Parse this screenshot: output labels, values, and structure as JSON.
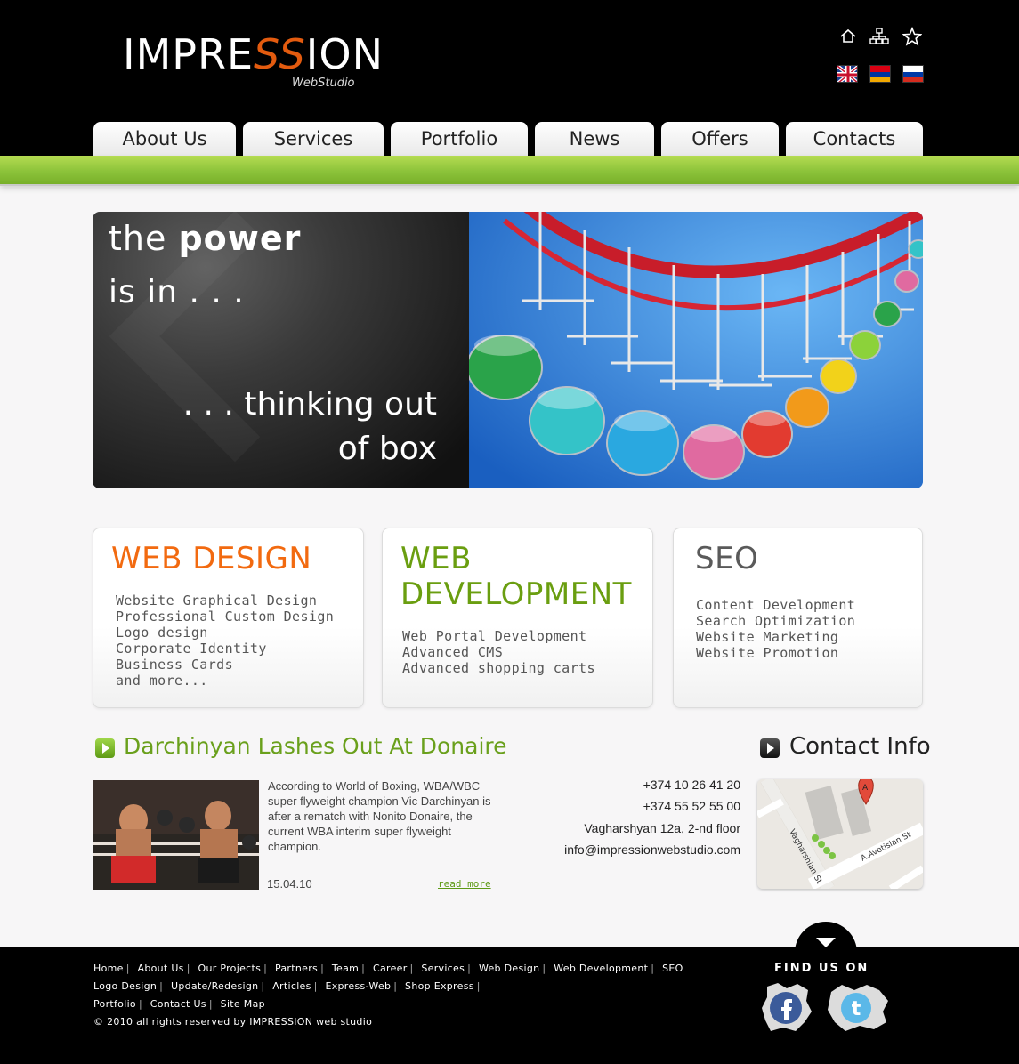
{
  "header": {
    "logo": {
      "main_left": "IMPRE",
      "main_ss": "SS",
      "main_right": "ION",
      "sub": "WebStudio"
    },
    "icons": [
      "home-icon",
      "sitemap-icon",
      "star-icon"
    ],
    "languages": [
      "English",
      "Armenian",
      "Russian"
    ]
  },
  "nav": {
    "tabs": [
      {
        "label": "About Us"
      },
      {
        "label": "Services"
      },
      {
        "label": "Portfolio"
      },
      {
        "label": "News"
      },
      {
        "label": "Offers"
      },
      {
        "label": "Contacts"
      }
    ]
  },
  "banner": {
    "line1_a": "the ",
    "line1_b": "power",
    "line2": "is in . . .",
    "line3": ". . . thinking out",
    "line4": "of box"
  },
  "services": [
    {
      "title": "WEB DESIGN",
      "color": "#f26a10",
      "items": [
        "Website Graphical Design",
        "Professional Custom Design",
        "Logo design",
        "Corporate Identity",
        "Business Cards",
        "and more..."
      ]
    },
    {
      "title_line1": "WEB",
      "title_line2": "DEVELOPMENT",
      "color": "#6a9e10",
      "items": [
        "Web Portal Development",
        "Advanced CMS",
        "Advanced shopping carts"
      ]
    },
    {
      "title": "SEO",
      "color": "#5a5a5a",
      "items": [
        "Content Development",
        "Search Optimization",
        "Website Marketing",
        "Website Promotion"
      ]
    }
  ],
  "news": {
    "title": "Darchinyan Lashes Out At Donaire",
    "text": "According to World of Boxing, WBA/WBC super flyweight champion Vic Darchinyan is after a rematch with Nonito Donaire, the current WBA interim super flyweight champion.",
    "date": "15.04.10",
    "read_more": "read more"
  },
  "contact": {
    "title": "Contact Info",
    "phone1": "+374 10 26 41 20",
    "phone2": "+374 55 52 55 00",
    "address": "Vagharshyan 12a, 2-nd floor",
    "email": "info@impressionwebstudio.com",
    "map": {
      "street1": "Vagharshian St",
      "street2": "A.Avetisian St",
      "marker": "A"
    }
  },
  "footer": {
    "row1": [
      "Home",
      "About Us",
      "Our Projects",
      "Partners",
      "Team",
      "Career",
      "Services",
      "Web Design",
      "Web Development",
      "SEO"
    ],
    "row2": [
      "Logo Design",
      "Update/Redesign",
      "Articles",
      "Express-Web",
      "Shop Express"
    ],
    "row3": [
      "Portfolio",
      "Contact Us",
      "Site Map"
    ],
    "copyright": "© 2010 all rights reserved by IMPRESSION web studio",
    "find_us": "FIND US ON",
    "social": [
      "facebook-icon",
      "twitter-icon"
    ]
  },
  "colors": {
    "green_bar": "#8cc33a",
    "news_title": "#6aa01c",
    "web_design": "#f26a10",
    "web_dev": "#6a9e10"
  }
}
